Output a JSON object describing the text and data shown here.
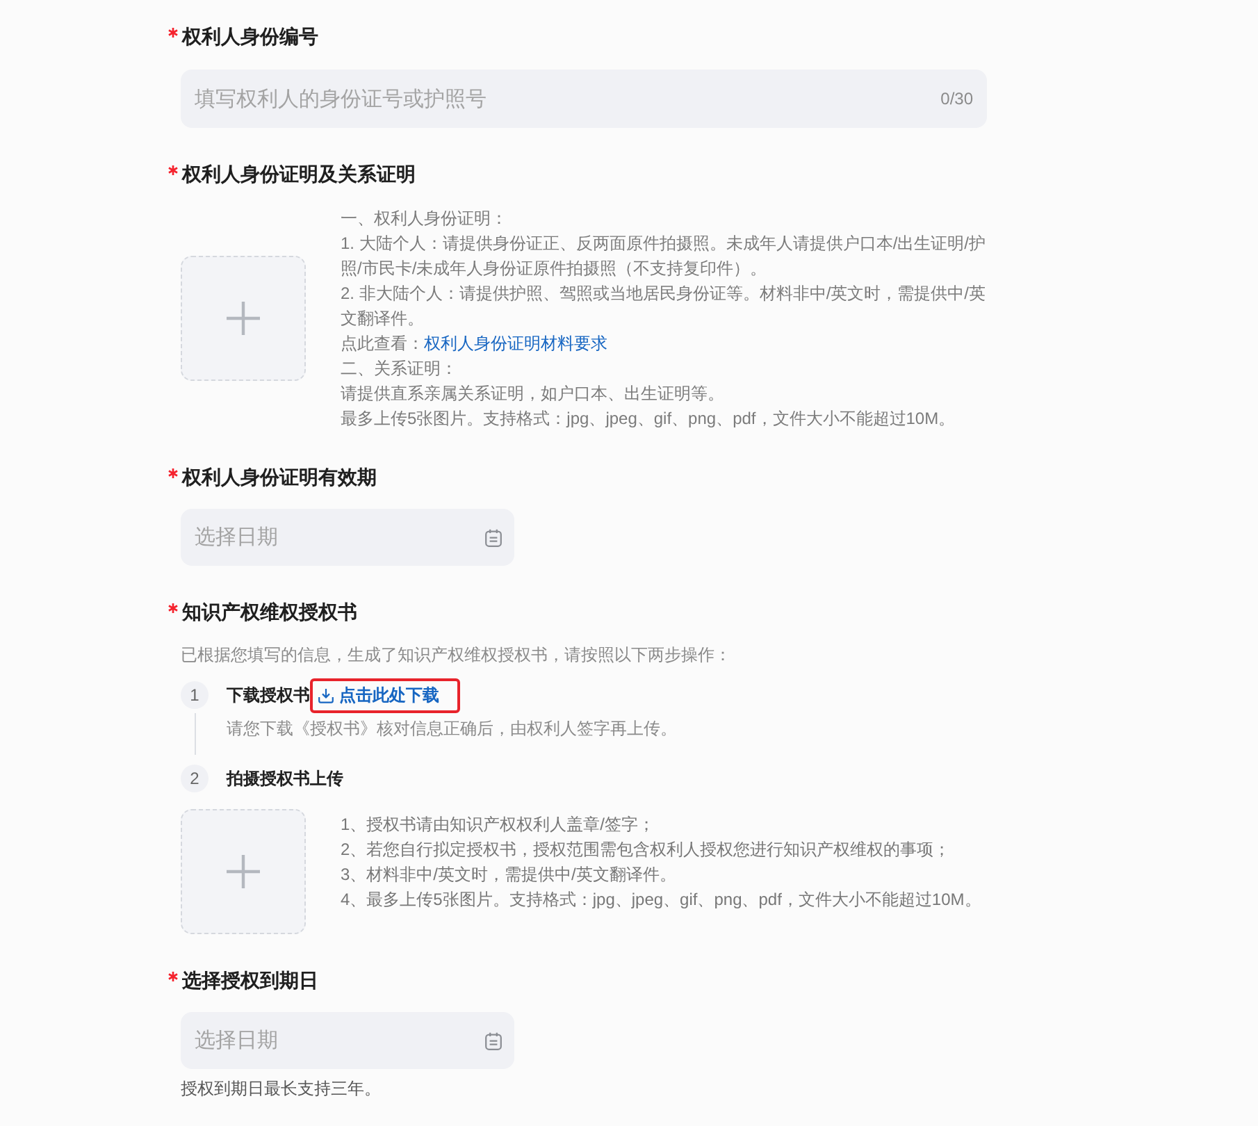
{
  "fields": [
    {
      "kind": "text",
      "label": "权利人身份编号",
      "required": true,
      "placeholder": "填写权利人的身份证号或护照号",
      "counter": "0/30"
    },
    {
      "kind": "upload",
      "label": "权利人身份证明及关系证明",
      "required": true,
      "help": [
        {
          "text": "一、权利人身份证明："
        },
        {
          "text": "1. 大陆个人：请提供身份证正、反两面原件拍摄照。未成年人请提供户口本/出生证明/护照/市民卡/未成年人身份证原件拍摄照（不支持复印件）。"
        },
        {
          "text": "2. 非大陆个人：请提供护照、驾照或当地居民身份证等。材料非中/英文时，需提供中/英文翻译件。"
        },
        {
          "text": "点此查看：",
          "link": "权利人身份证明材料要求"
        },
        {
          "text": "二、关系证明："
        },
        {
          "text": "请提供直系亲属关系证明，如户口本、出生证明等。"
        },
        {
          "text": "最多上传5张图片。支持格式：jpg、jpeg、gif、png、pdf，文件大小不能超过10M。"
        }
      ]
    },
    {
      "kind": "date",
      "label": "权利人身份证明有效期",
      "required": true,
      "placeholder": "选择日期"
    },
    {
      "kind": "steps",
      "label": "知识产权维权授权书",
      "required": true,
      "description": "已根据您填写的信息，生成了知识产权维权授权书，请按照以下两步操作：",
      "steps": [
        {
          "kind": "download",
          "number": "1",
          "title": "下载授权书",
          "action": {
            "label": "点击此处下载",
            "highlighted": true
          },
          "note": "请您下载《授权书》核对信息正确后，由权利人签字再上传。"
        },
        {
          "kind": "upload",
          "number": "2",
          "title": "拍摄授权书上传",
          "help": [
            {
              "text": "1、授权书请由知识产权权利人盖章/签字；"
            },
            {
              "text": "2、若您自行拟定授权书，授权范围需包含权利人授权您进行知识产权维权的事项；"
            },
            {
              "text": "3、材料非中/英文时，需提供中/英文翻译件。"
            },
            {
              "text": "4、最多上传5张图片。支持格式：jpg、jpeg、gif、png、pdf，文件大小不能超过10M。"
            }
          ]
        }
      ]
    },
    {
      "kind": "date",
      "label": "选择授权到期日",
      "required": true,
      "placeholder": "选择日期",
      "hint": "授权到期日最长支持三年。"
    }
  ]
}
